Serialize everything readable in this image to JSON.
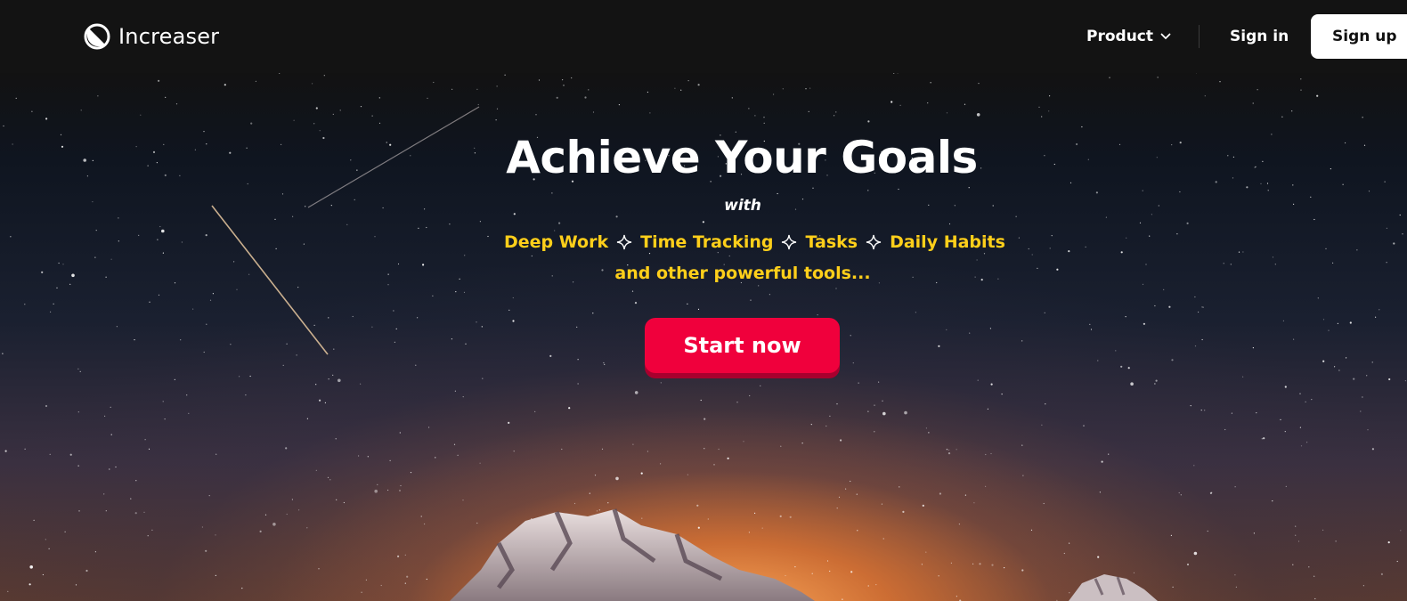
{
  "nav": {
    "brand": "Increaser",
    "brand_icon": "increaser-logo-icon",
    "product_label": "Product",
    "product_icon": "chevron-down-icon",
    "signin_label": "Sign in",
    "signup_label": "Sign up"
  },
  "hero": {
    "headline": "Achieve Your Goals",
    "with": "with",
    "features": [
      "Deep Work",
      "Time Tracking",
      "Tasks",
      "Daily Habits"
    ],
    "separator_icon": "sparkle-icon",
    "tagline": "and other powerful tools...",
    "cta_label": "Start now"
  },
  "colors": {
    "accent": "#f0003c",
    "feature_text": "#ffcf1a",
    "nav_background": "#131313"
  }
}
